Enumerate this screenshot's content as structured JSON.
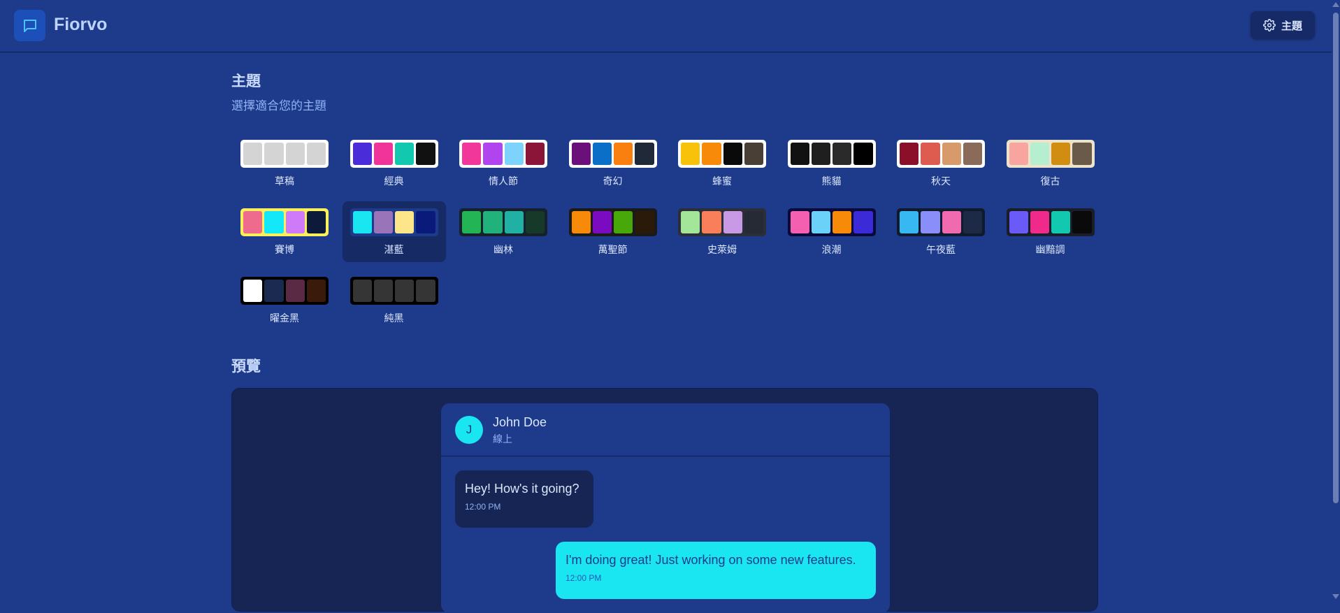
{
  "app": {
    "name": "Fiorvo",
    "logo_icon": "chat-bubble-icon"
  },
  "header": {
    "theme_button_label": "主題",
    "theme_button_icon": "gear-icon"
  },
  "themes_section": {
    "title": "主題",
    "subtitle": "選擇適合您的主題",
    "selected": "湛藍",
    "items": [
      {
        "label": "草稿",
        "frame": "#ffffff",
        "colors": [
          "#d4d4d4",
          "#d4d4d4",
          "#d4d4d4",
          "#d4d4d4"
        ]
      },
      {
        "label": "經典",
        "frame": "#ffffff",
        "colors": [
          "#4a2cd8",
          "#f0349a",
          "#12c9b0",
          "#111111"
        ]
      },
      {
        "label": "情人節",
        "frame": "#ffffff",
        "colors": [
          "#f2379a",
          "#b045f0",
          "#7dd3fc",
          "#8a1538"
        ]
      },
      {
        "label": "奇幻",
        "frame": "#ffffff",
        "colors": [
          "#6b0f7a",
          "#0b6fc7",
          "#f97f0f",
          "#1f2937"
        ]
      },
      {
        "label": "蜂蜜",
        "frame": "#ffffff",
        "colors": [
          "#f8c20a",
          "#f88a0a",
          "#0a0a0a",
          "#4a3f36"
        ]
      },
      {
        "label": "熊貓",
        "frame": "#ffffff",
        "colors": [
          "#111111",
          "#1f1f1f",
          "#2a2a2a",
          "#000000"
        ]
      },
      {
        "label": "秋天",
        "frame": "#ffffff",
        "colors": [
          "#8c0f2a",
          "#de5c4f",
          "#d69a6b",
          "#8a6b5a"
        ]
      },
      {
        "label": "復古",
        "frame": "#ece3ca",
        "colors": [
          "#f8a5a0",
          "#b6efcf",
          "#d08d12",
          "#6a5a4a"
        ]
      },
      {
        "label": "賽博",
        "frame": "#fcef5c",
        "colors": [
          "#ef6b8e",
          "#12e8f8",
          "#cf7af8",
          "#0e1a3a"
        ]
      },
      {
        "label": "湛藍",
        "frame": "#1e3a8a",
        "colors": [
          "#19e6f0",
          "#9a74b8",
          "#fde68a",
          "#0a1a7a"
        ]
      },
      {
        "label": "幽林",
        "frame": "#16212b",
        "colors": [
          "#22b455",
          "#21b17a",
          "#21b1a4",
          "#17392a"
        ]
      },
      {
        "label": "萬聖節",
        "frame": "#1a1a1a",
        "colors": [
          "#f88a0a",
          "#7a0bc0",
          "#48a80a",
          "#2a1a0a"
        ]
      },
      {
        "label": "史萊姆",
        "frame": "#2a2f3a",
        "colors": [
          "#a3e69a",
          "#f97f5a",
          "#c89ae6",
          "#252a35"
        ]
      },
      {
        "label": "浪潮",
        "frame": "#0a0a3a",
        "colors": [
          "#f55fb0",
          "#6bd1f8",
          "#f88a0a",
          "#3a2ad8"
        ]
      },
      {
        "label": "午夜藍",
        "frame": "#101a2e",
        "colors": [
          "#38b8f2",
          "#8a8ef8",
          "#f06ab0",
          "#1c2a45"
        ]
      },
      {
        "label": "幽黯調",
        "frame": "#1a1d2a",
        "colors": [
          "#6a5af8",
          "#ef2a8a",
          "#12c9b0",
          "#0a0a0a"
        ]
      },
      {
        "label": "曜金黑",
        "frame": "#000000",
        "colors": [
          "#ffffff",
          "#1a2a50",
          "#5a2a45",
          "#3a1a0a"
        ]
      },
      {
        "label": "純黑",
        "frame": "#000000",
        "colors": [
          "#353535",
          "#353535",
          "#353535",
          "#353535"
        ]
      }
    ]
  },
  "preview_section": {
    "title": "預覽",
    "contact": {
      "initial": "J",
      "name": "John Doe",
      "status": "線上"
    },
    "messages": [
      {
        "direction": "incoming",
        "text": "Hey! How's it going?",
        "time": "12:00 PM"
      },
      {
        "direction": "outgoing",
        "text": "I'm doing great! Just working on some new features.",
        "time": "12:00 PM"
      }
    ]
  },
  "colors": {
    "background": "#1e3a8a",
    "accent": "#19e6f0",
    "panel": "#172554"
  }
}
